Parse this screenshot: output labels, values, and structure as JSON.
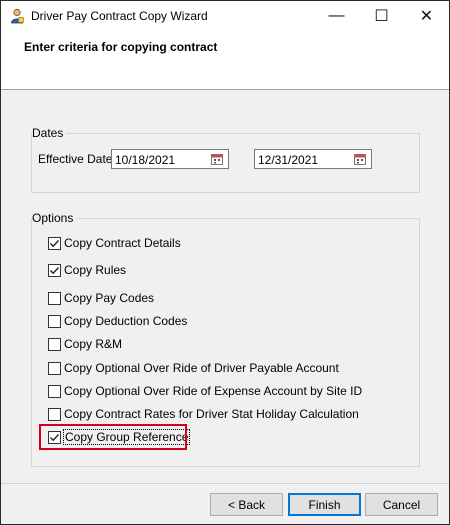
{
  "window": {
    "title": "Driver Pay Contract Copy Wizard",
    "minimize_glyph": "—",
    "maximize_glyph": "☐",
    "close_glyph": "✕"
  },
  "header": {
    "instruction": "Enter criteria for copying contract"
  },
  "dates": {
    "group_label": "Dates",
    "effective_dates_label": "Effective Dates",
    "start_date": "10/18/2021",
    "end_date": "12/31/2021",
    "calendar_icon": "calendar-icon"
  },
  "options": {
    "group_label": "Options",
    "items": [
      {
        "label": "Copy Contract Details",
        "checked": true
      },
      {
        "label": "Copy Rules",
        "checked": true
      },
      {
        "label": "Copy Pay Codes",
        "checked": false
      },
      {
        "label": "Copy Deduction Codes",
        "checked": false
      },
      {
        "label": "Copy R&M",
        "checked": false
      },
      {
        "label": "Copy Optional Over Ride of Driver Payable Account",
        "checked": false
      },
      {
        "label": "Copy Optional Over Ride of Expense Account by Site ID",
        "checked": false
      },
      {
        "label": "Copy Contract Rates for Driver Stat Holiday Calculation",
        "checked": false
      },
      {
        "label": "Copy Group Reference",
        "checked": true
      }
    ]
  },
  "buttons": {
    "back": "< Back",
    "finish": "Finish",
    "cancel": "Cancel"
  },
  "colors": {
    "highlight": "#d0021b",
    "default_button_border": "#0078d7"
  }
}
